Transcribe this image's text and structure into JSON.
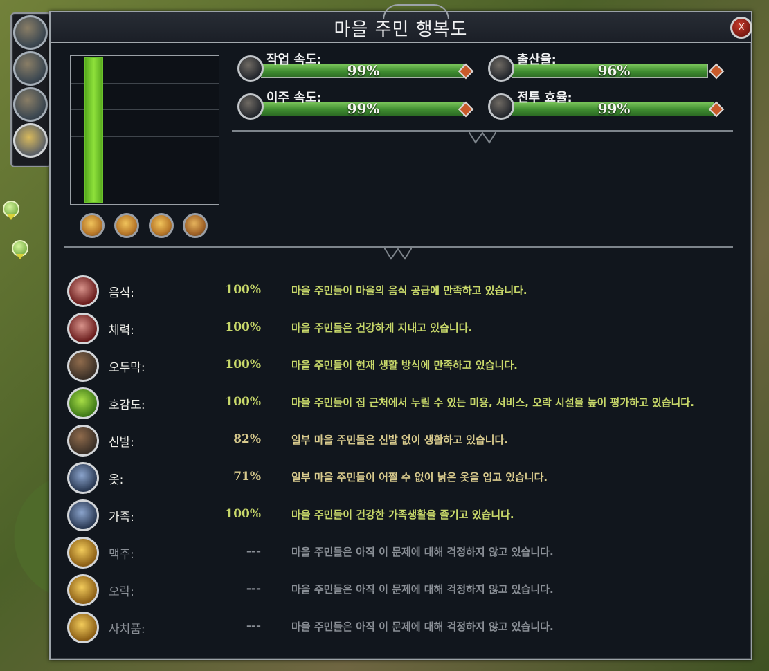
{
  "window": {
    "title": "마을 주민 행복도",
    "close_label": "X"
  },
  "chart_data": {
    "type": "bar",
    "categories": [
      ""
    ],
    "values": [
      100
    ],
    "ylim": [
      0,
      100
    ],
    "grid": true
  },
  "left_nav": {
    "items": [
      {
        "icon": "helmet-icon"
      },
      {
        "icon": "villagers-icon"
      },
      {
        "icon": "barrels-icon"
      },
      {
        "icon": "masks-icon",
        "active": true
      }
    ]
  },
  "mood_masks": [
    {
      "icon": "happy-mask-icon"
    },
    {
      "icon": "content-mask-icon"
    },
    {
      "icon": "neutral-mask-icon"
    },
    {
      "icon": "sad-mask-icon"
    }
  ],
  "stats": [
    {
      "label": "작업 속도:",
      "value": "99%",
      "fill": 0.99,
      "icon": "hammer-icon"
    },
    {
      "label": "출산율:",
      "value": "96%",
      "fill": 0.96,
      "icon": "cradle-icon"
    },
    {
      "label": "이주 속도:",
      "value": "99%",
      "fill": 0.99,
      "icon": "wagon-icon"
    },
    {
      "label": "전투 효율:",
      "value": "99%",
      "fill": 0.99,
      "icon": "sword-icon"
    }
  ],
  "needs": [
    {
      "icon": "meat-icon",
      "label": "음식:",
      "value": "100%",
      "desc": "마을 주민들이 마을의 음식 공급에 만족하고 있습니다.",
      "status": "ok"
    },
    {
      "icon": "caduceus-icon",
      "label": "체력:",
      "value": "100%",
      "desc": "마을 주민들은 건강하게 지내고 있습니다.",
      "status": "ok"
    },
    {
      "icon": "hut-icon",
      "label": "오두막:",
      "value": "100%",
      "desc": "마을 주민들이 현재 생활 방식에 만족하고 있습니다.",
      "status": "ok"
    },
    {
      "icon": "chevron-up-icon",
      "label": "호감도:",
      "value": "100%",
      "desc": "마을 주민들이 집 근처에서 누릴 수 있는 미용, 서비스, 오락 시설을 높이 평가하고 있습니다.",
      "status": "ok"
    },
    {
      "icon": "shoes-icon",
      "label": "신발:",
      "value": "82%",
      "desc": "일부 마을 주민들은 신발 없이 생활하고 있습니다.",
      "status": "warn"
    },
    {
      "icon": "clothes-icon",
      "label": "옷:",
      "value": "71%",
      "desc": "일부 마을 주민들이 어쩔 수 없이 낡은 옷을 입고 있습니다.",
      "status": "warn"
    },
    {
      "icon": "family-icon",
      "label": "가족:",
      "value": "100%",
      "desc": "마을 주민들이 건강한 가족생활을 즐기고 있습니다.",
      "status": "ok"
    },
    {
      "icon": "beer-icon",
      "label": "맥주:",
      "value": "---",
      "desc": "마을 주민들은 아직 이 문제에 대해 걱정하지 않고 있습니다.",
      "status": "dim"
    },
    {
      "icon": "crossed-tools-icon",
      "label": "오락:",
      "value": "---",
      "desc": "마을 주민들은 아직 이 문제에 대해 걱정하지 않고 있습니다.",
      "status": "dim"
    },
    {
      "icon": "luxury-goods-icon",
      "label": "사치품:",
      "value": "---",
      "desc": "마을 주민들은 아직 이 문제에 대해 걱정하지 않고 있습니다.",
      "status": "dim"
    }
  ]
}
